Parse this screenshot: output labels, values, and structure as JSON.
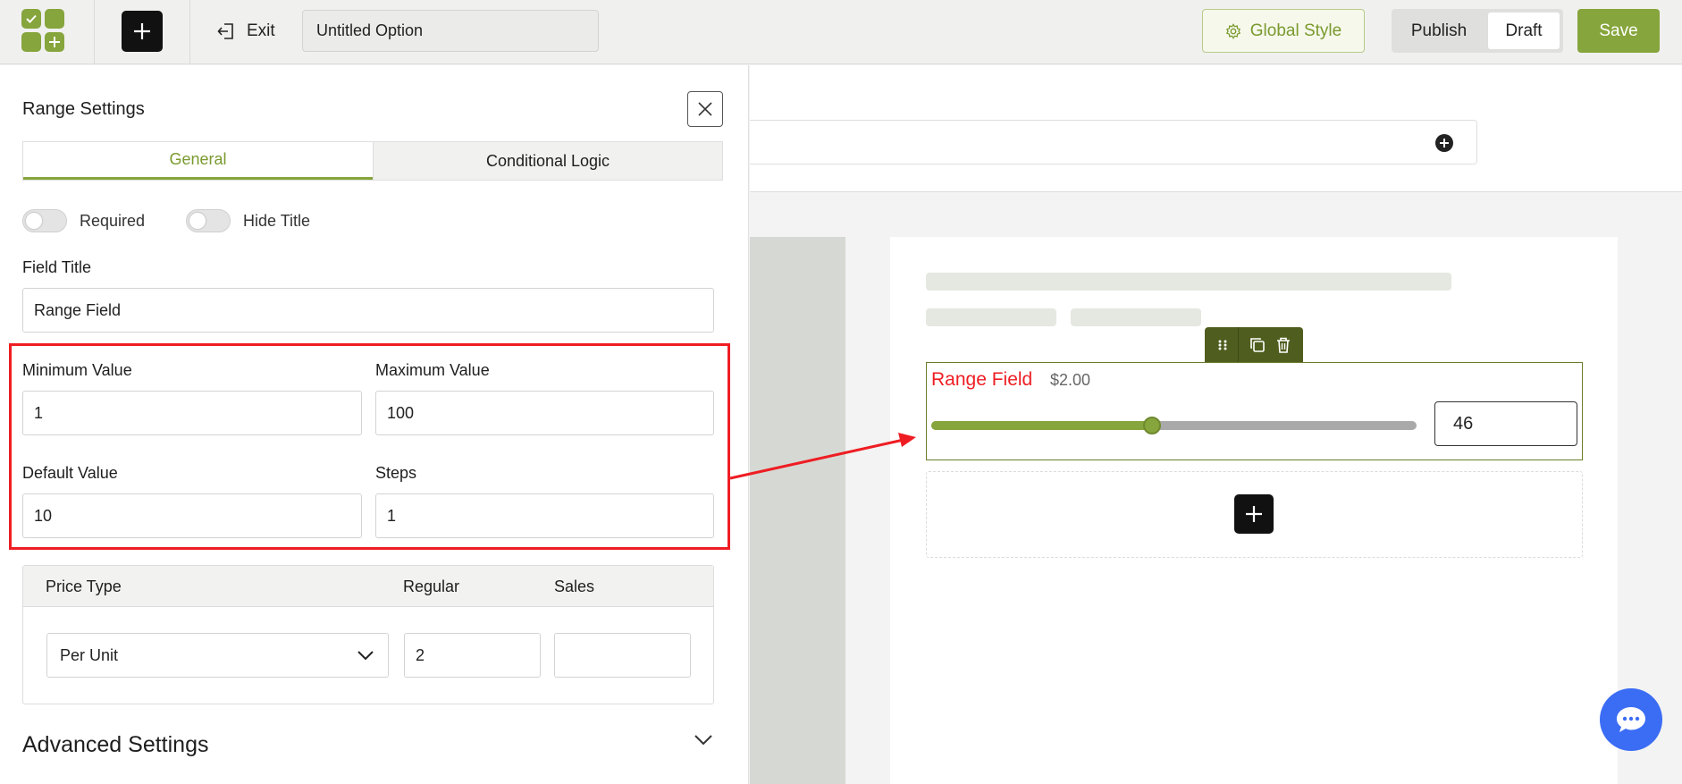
{
  "topbar": {
    "exit_label": "Exit",
    "option_title": "Untitled Option",
    "global_style_label": "Global Style",
    "publish_label": "Publish",
    "draft_label": "Draft",
    "save_label": "Save"
  },
  "panel": {
    "title": "Range Settings",
    "tabs": [
      "General",
      "Conditional Logic"
    ],
    "active_tab": "General",
    "toggles": {
      "required": {
        "label": "Required",
        "on": false
      },
      "hide_title": {
        "label": "Hide Title",
        "on": false
      }
    },
    "field_title": {
      "label": "Field Title",
      "value": "Range Field"
    },
    "min_value": {
      "label": "Minimum Value",
      "value": "1"
    },
    "max_value": {
      "label": "Maximum Value",
      "value": "100"
    },
    "default_value": {
      "label": "Default Value",
      "value": "10"
    },
    "steps": {
      "label": "Steps",
      "value": "1"
    },
    "price": {
      "headers": {
        "type": "Price Type",
        "regular": "Regular",
        "sales": "Sales"
      },
      "type_value": "Per Unit",
      "regular_value": "2",
      "sales_value": ""
    },
    "advanced_label": "Advanced Settings"
  },
  "preview": {
    "field_title": "Range Field",
    "price_label": "$2.00",
    "range_value": "46",
    "range_min": 1,
    "range_max": 100,
    "range_current": 46
  },
  "colors": {
    "accent": "#86a53c",
    "highlight": "#ee1d23",
    "chat": "#3b6cf4"
  }
}
